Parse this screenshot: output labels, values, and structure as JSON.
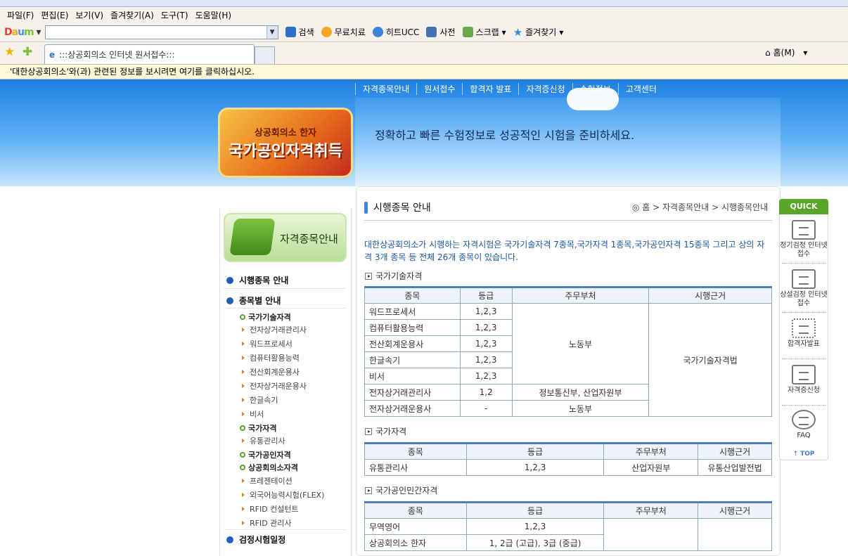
{
  "browser": {
    "menu": [
      "파일(F)",
      "편집(E)",
      "보기(V)",
      "즐겨찾기(A)",
      "도구(T)",
      "도움말(H)"
    ],
    "toolbar": {
      "search_label": "검색",
      "free_label": "무료치료",
      "ucc_label": "히트UCC",
      "dict_label": "사전",
      "scrap_label": "스크랩",
      "fav_label": "즐겨찾기"
    },
    "tab_title": ":::상공회의소 인터넷 원서접수:::",
    "home_label": "홈(M)",
    "infobar": "'대한상공회의소'와(과) 관련된 정보를 보시려면 여기를 클릭하십시오."
  },
  "nav": [
    "자격종목안내",
    "원서접수",
    "합격자 발표",
    "자격증신청",
    "수험정보",
    "고객센터"
  ],
  "banner": {
    "logo_small": "상공회의소 한자",
    "logo_big": "국가공인자격취득",
    "slogan": "정확하고 빠른 수험정보로 성공적인 시험을 준비하세요."
  },
  "left_menu": {
    "title": "자격종목안내",
    "main1": "시행종목 안내",
    "main2": "종목별 안내",
    "sub_national_tech": "국가기술자격",
    "items_tech": [
      "전자상거래관리사",
      "워드프로세서",
      "컴퓨터활용능력",
      "전산회계운용사",
      "전자상거래운용사",
      "한글속기",
      "비서"
    ],
    "sub_national": "국가자격",
    "items_national": [
      "유통관리사"
    ],
    "sub_public": "국가공인자격",
    "sub_chamber": "상공회의소자격",
    "items_chamber": [
      "프레젠테이션",
      "외국어능력시험(FLEX)",
      "RFID 컨설턴트",
      "RFID 관리사"
    ],
    "main3": "검정시험일정"
  },
  "content": {
    "title": "시행종목 안내",
    "breadcrumb": "홈 > 자격종목안내 > 시행종목안내",
    "intro": "대한상공회의소가 시행하는 자격시험은 국가기술자격 7종목,국가자격 1종목,국가공인자격 15종목 그리고 상의 자격 3개 종목 등 전체 26개 종목이 있습니다.",
    "section1": "국가기술자격",
    "section2": "국가자격",
    "section3": "국가공인민간자격",
    "headers": [
      "종목",
      "등급",
      "주무부처",
      "시행근거"
    ],
    "table1": {
      "rows": [
        {
          "name": "워드프로세서",
          "grade": "1,2,3"
        },
        {
          "name": "컴퓨터활용능력",
          "grade": "1,2,3"
        },
        {
          "name": "전산회계운용사",
          "grade": "1,2,3"
        },
        {
          "name": "한글속기",
          "grade": "1,2,3"
        },
        {
          "name": "비서",
          "grade": "1,2,3"
        },
        {
          "name": "전자상거래관리사",
          "grade": "1,2"
        },
        {
          "name": "전자상거래운용사",
          "grade": "-"
        }
      ],
      "ministry_labor": "노동부",
      "ministry_info": "정보통신부, 산업자원부",
      "ministry_labor2": "노동부",
      "basis": "국가기술자격법"
    },
    "table2": {
      "name": "유통관리사",
      "grade": "1,2,3",
      "ministry": "산업자원부",
      "basis": "유통산업발전법"
    },
    "table3": {
      "rows": [
        {
          "name": "무역영어",
          "grade": "1,2,3"
        },
        {
          "name": "상공회의소 한자",
          "grade": "1, 2급 (고급), 3급 (중급)"
        }
      ]
    }
  },
  "quick_menu": {
    "head": "QUICK menu",
    "items": [
      "정기검정 인터넷접수",
      "상설검정 인터넷접수",
      "합격자발표",
      "자격증신청",
      "FAQ"
    ],
    "top": "TOP"
  }
}
